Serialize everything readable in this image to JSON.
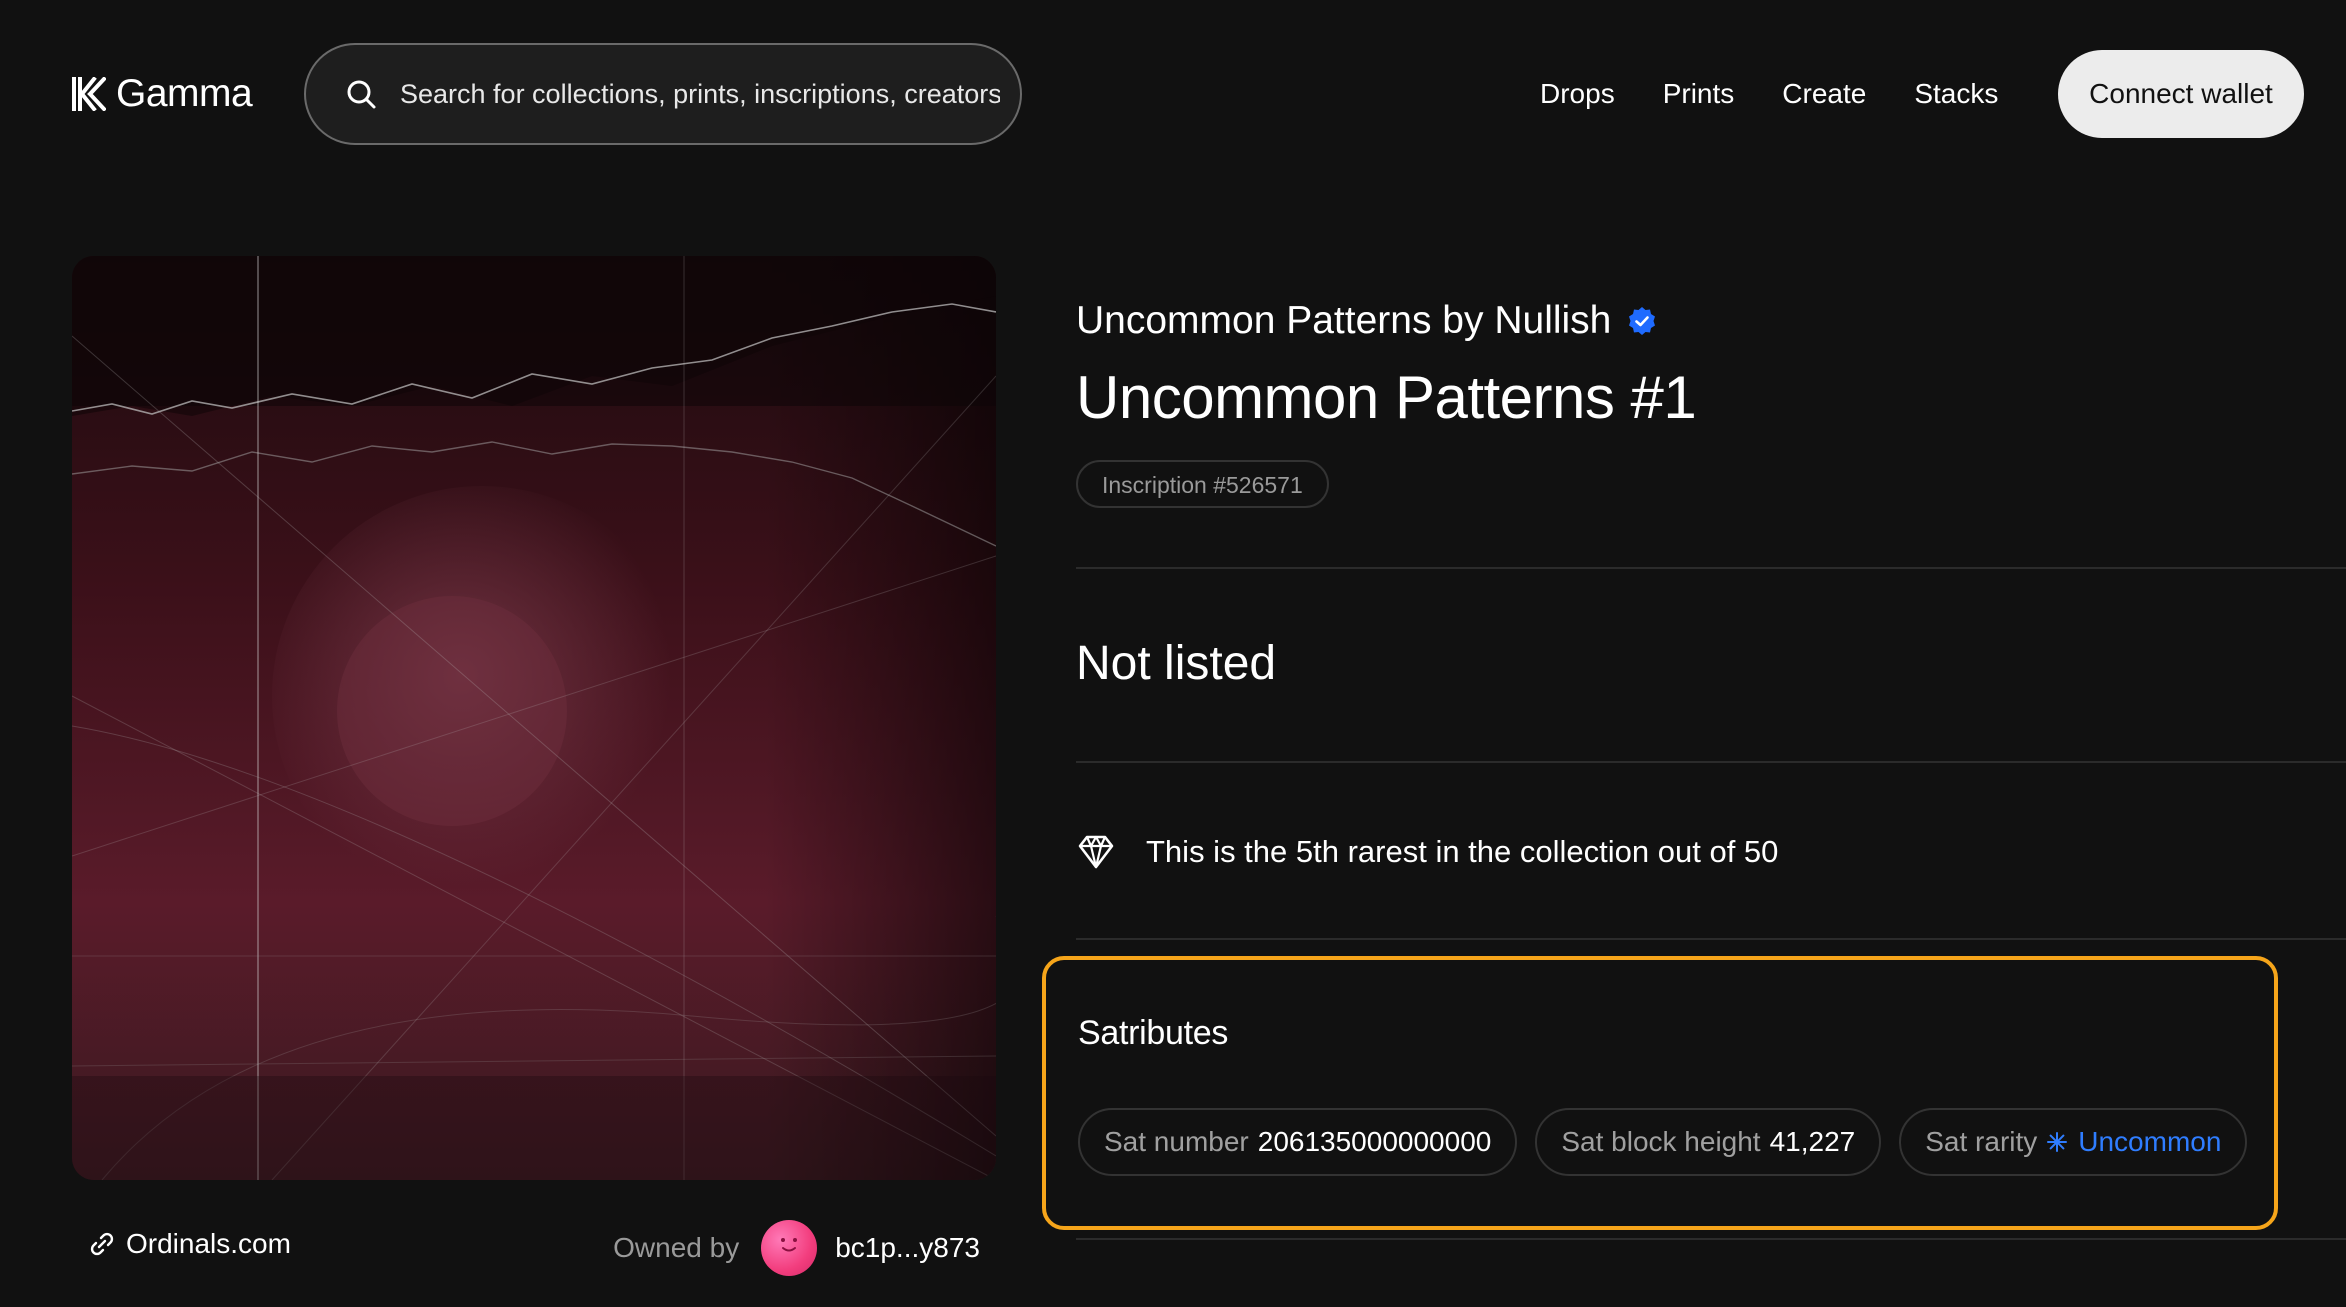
{
  "header": {
    "logo_text": "Gamma",
    "search_placeholder": "Search for collections, prints, inscriptions, creators",
    "nav": [
      "Drops",
      "Prints",
      "Create",
      "Stacks"
    ],
    "connect_label": "Connect wallet"
  },
  "artwork": {
    "footer_link": "Ordinals.com",
    "owned_label": "Owned by",
    "owner": "bc1p...y873"
  },
  "item": {
    "collection": "Uncommon Patterns by Nullish",
    "title": "Uncommon Patterns #1",
    "inscription": "Inscription #526571",
    "listing_status": "Not listed",
    "rarity_text": "This is the 5th rarest in the collection out of 50"
  },
  "satributes": {
    "title": "Satributes",
    "sat_number_label": "Sat number",
    "sat_number": "206135000000000",
    "block_height_label": "Sat block height",
    "block_height": "41,227",
    "rarity_label": "Sat rarity",
    "rarity_value": "Uncommon"
  },
  "colors": {
    "background": "#111111",
    "highlight_border": "#f6a51a",
    "uncommon_blue": "#2f7dff",
    "verified_blue": "#1f6bff"
  },
  "icons": [
    "gamma-logo-icon",
    "search-icon",
    "link-icon",
    "verified-badge-icon",
    "diamond-icon",
    "sparkle-icon"
  ]
}
